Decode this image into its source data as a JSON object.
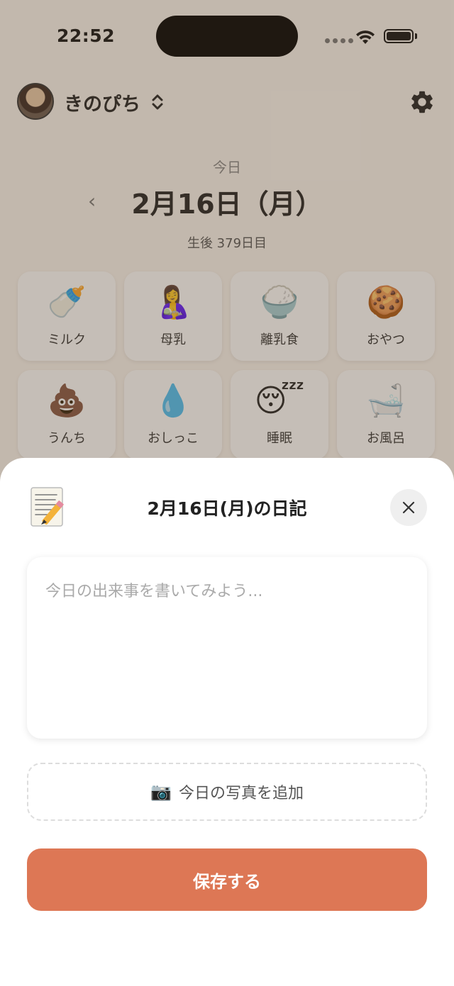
{
  "status_bar": {
    "time": "22:52"
  },
  "header": {
    "user_name": "きのぴち"
  },
  "date_nav": {
    "today_label": "今日",
    "prev_arrow": "‹",
    "date_title": "2月16日（月）",
    "age_label": "生後 379日目"
  },
  "categories": [
    {
      "icon": "🍼",
      "label": "ミルク"
    },
    {
      "icon": "🤱",
      "label": "母乳"
    },
    {
      "icon": "🍚",
      "label": "離乳食"
    },
    {
      "icon": "🍪",
      "label": "おやつ"
    },
    {
      "icon": "💩",
      "label": "うんち"
    },
    {
      "icon": "💧",
      "label": "おしっこ"
    },
    {
      "icon": "😴",
      "label": "睡眠"
    },
    {
      "icon": "🛁",
      "label": "お風呂"
    }
  ],
  "diary_sheet": {
    "title": "2月16日(月)の日記",
    "placeholder": "今日の出来事を書いてみよう...",
    "photo_icon": "📷",
    "photo_label": "今日の写真を追加",
    "save_label": "保存する"
  },
  "colors": {
    "background": "#fbf6f0",
    "accent": "#dd7755",
    "overlay": "rgba(90,70,50,0.35)"
  },
  "icons": {
    "settings": "gear-icon",
    "close": "close-icon",
    "account_switch": "chevron-up-down-icon",
    "memo": "memo-icon"
  }
}
